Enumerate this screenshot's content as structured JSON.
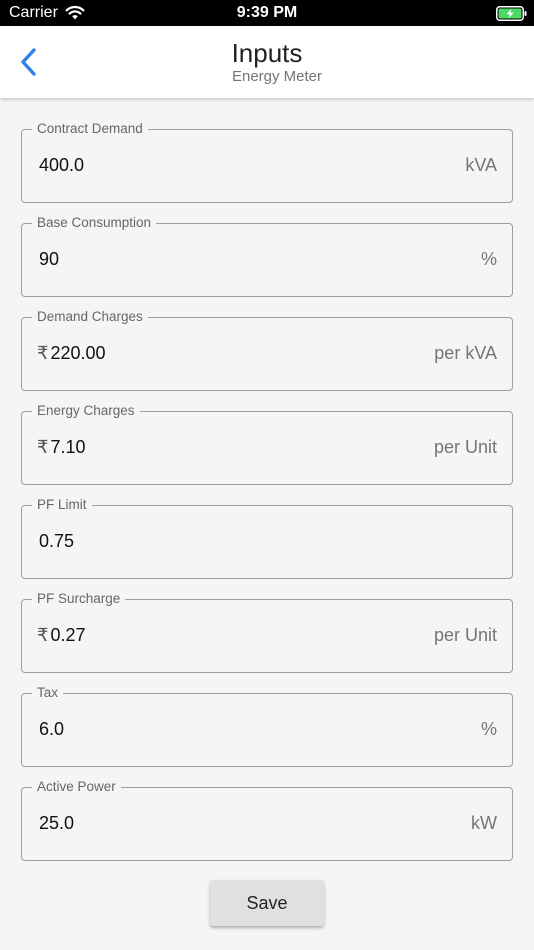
{
  "status_bar": {
    "carrier": "Carrier",
    "time": "9:39 PM"
  },
  "header": {
    "title": "Inputs",
    "subtitle": "Energy Meter"
  },
  "fields": [
    {
      "label": "Contract Demand",
      "prefix": "",
      "value": "400.0",
      "suffix": "kVA"
    },
    {
      "label": "Base Consumption",
      "prefix": "",
      "value": "90",
      "suffix": "%"
    },
    {
      "label": "Demand Charges",
      "prefix": "₹",
      "value": "220.00",
      "suffix": "per kVA"
    },
    {
      "label": "Energy Charges",
      "prefix": "₹",
      "value": "7.10",
      "suffix": "per Unit"
    },
    {
      "label": "PF Limit",
      "prefix": "",
      "value": "0.75",
      "suffix": ""
    },
    {
      "label": "PF Surcharge",
      "prefix": "₹",
      "value": "0.27",
      "suffix": "per Unit"
    },
    {
      "label": "Tax",
      "prefix": "",
      "value": "6.0",
      "suffix": "%"
    },
    {
      "label": "Active Power",
      "prefix": "",
      "value": "25.0",
      "suffix": "kW"
    }
  ],
  "actions": {
    "save_label": "Save"
  },
  "colors": {
    "accent": "#2f80ed",
    "battery": "#4cd964"
  },
  "icons": {
    "back": "chevron-left-icon",
    "wifi": "wifi-icon",
    "battery": "battery-charging-icon"
  }
}
